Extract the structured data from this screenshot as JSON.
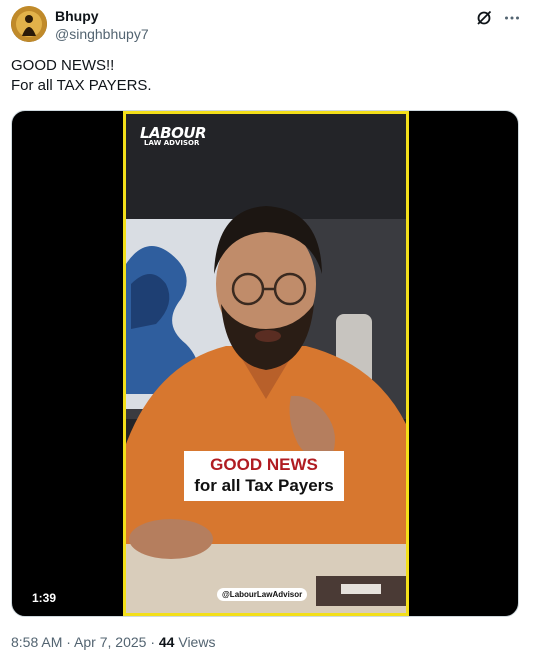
{
  "author": {
    "name": "Bhupy",
    "handle": "@singhbhupy7"
  },
  "tweet": {
    "lines": [
      "GOOD NEWS!!",
      "For all TAX PAYERS."
    ]
  },
  "video": {
    "logo_big": "LABOUR",
    "logo_small": "LAW ADVISOR",
    "caption_line1": "GOOD NEWS",
    "caption_line2": "for all Tax Payers",
    "watermark": "@LabourLawAdvisor",
    "duration": "1:39",
    "border_color": "#f3df1a"
  },
  "meta": {
    "time": "8:58 AM",
    "sep1": " · ",
    "date": "Apr 7, 2025",
    "sep2": " · ",
    "views_count": "44",
    "views_label": " Views"
  },
  "icons": {
    "grok": "grok-icon",
    "more": "more-icon"
  }
}
